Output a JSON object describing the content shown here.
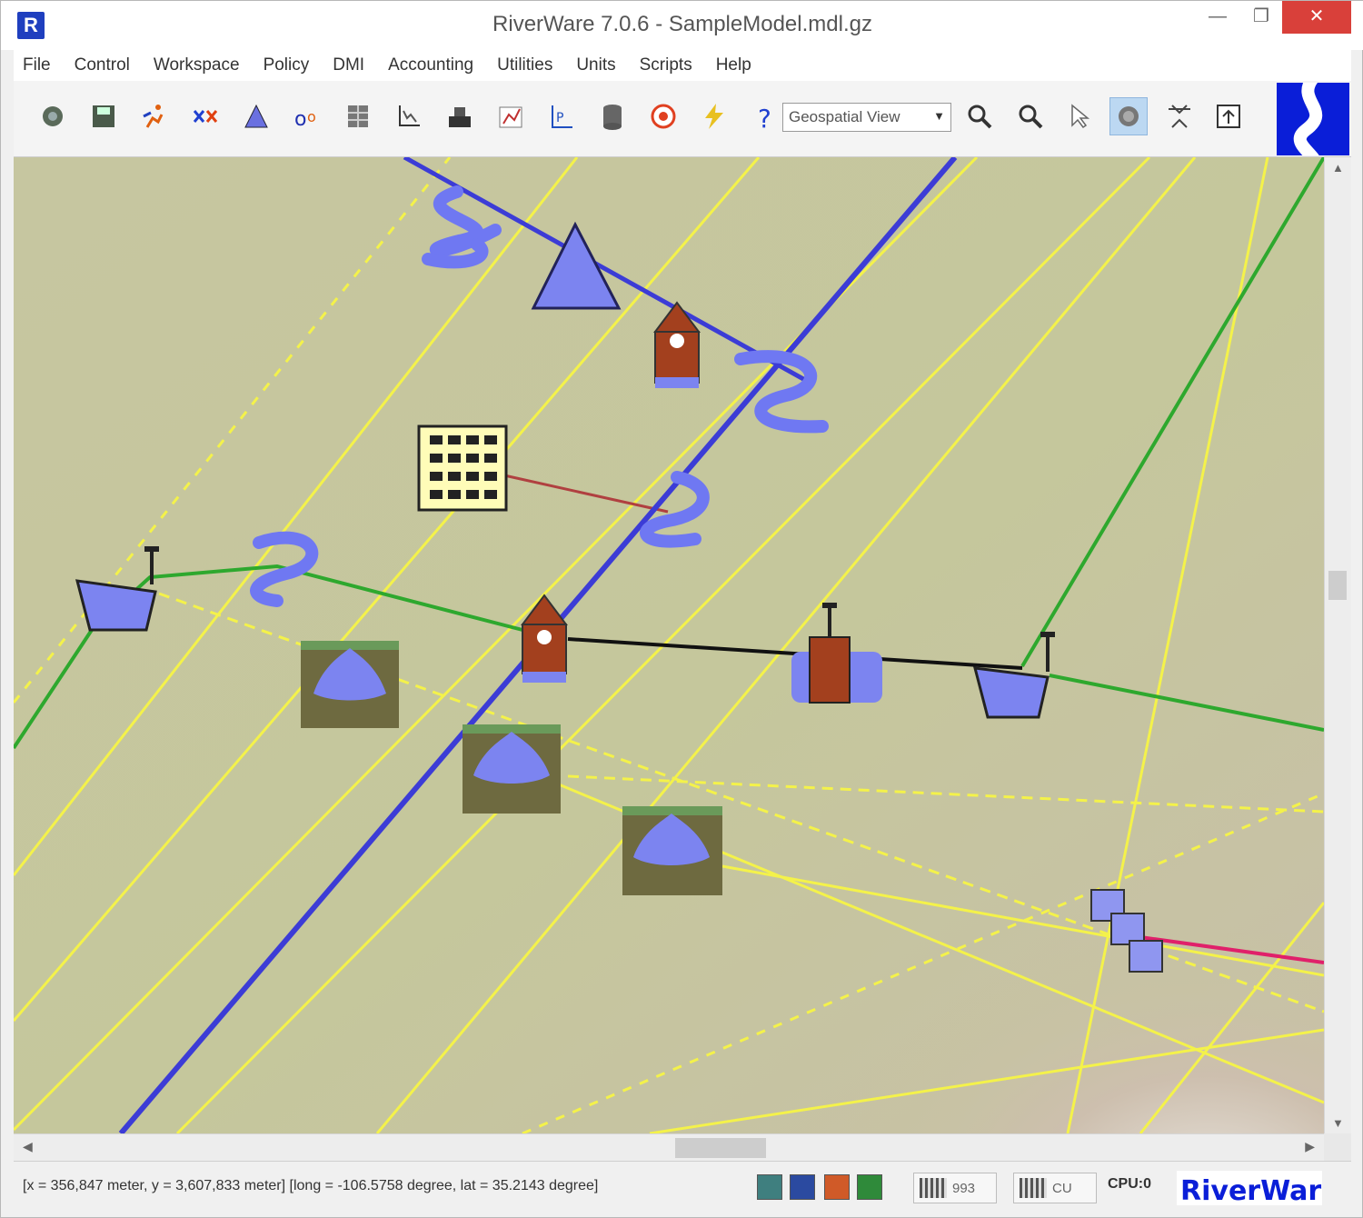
{
  "window": {
    "title": "RiverWare 7.0.6 - SampleModel.mdl.gz",
    "app_icon_glyph": "R",
    "minimize_glyph": "—",
    "maximize_glyph": "❐",
    "close_glyph": "✕"
  },
  "menu": {
    "items": [
      "File",
      "Control",
      "Workspace",
      "Policy",
      "DMI",
      "Accounting",
      "Utilities",
      "Units",
      "Scripts",
      "Help"
    ]
  },
  "toolbar": {
    "icons": [
      "open-icon",
      "save-icon",
      "run-icon",
      "simulate-icon",
      "reservoir-icon",
      "object-icon",
      "table-icon",
      "plot-icon",
      "tools-icon",
      "graph-icon",
      "report-icon",
      "database-icon",
      "stop-icon",
      "lightning-icon",
      "help-icon"
    ],
    "view_selector": {
      "value": "Geospatial View"
    },
    "map_tools": [
      "zoom-in-icon",
      "zoom-out-icon",
      "pointer-icon",
      "pan-icon",
      "fit-icon",
      "export-icon"
    ],
    "active_tool": "pan-icon"
  },
  "statusbar": {
    "coordinates": "[x = 356,847 meter, y = 3,607,833 meter] [long = -106.5758 degree, lat = 35.2143 degree]",
    "memory1": "993",
    "memory2": "CU",
    "cpu_label": "CPU:0",
    "brand": "RiverWare"
  },
  "colors": {
    "river": "#3c3cd6",
    "link_yellow": "#f4f24a",
    "link_green": "#2ea82e",
    "link_black": "#111111",
    "link_red": "#b04040",
    "link_magenta": "#e0206a",
    "object_blue": "#7c84f0",
    "object_brown": "#a3401e",
    "terrain": "#c8c69a",
    "brand_blue": "#0a1ed8"
  }
}
